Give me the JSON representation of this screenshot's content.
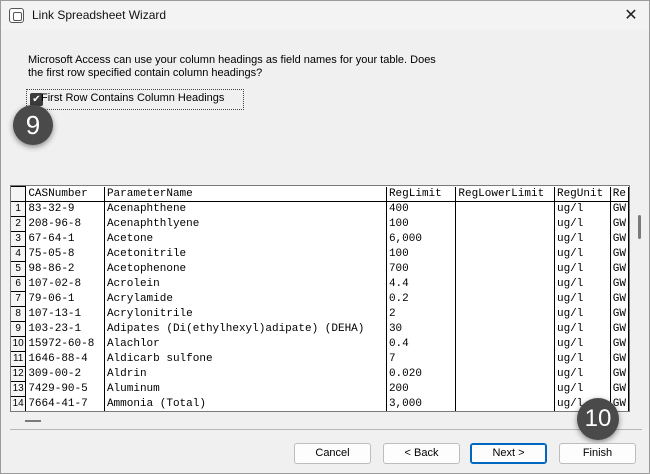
{
  "window": {
    "title": "Link Spreadsheet Wizard",
    "close_symbol": "✕"
  },
  "instructions": "Microsoft Access can use your column headings as field names for your table. Does the first row specified contain column headings?",
  "checkbox": {
    "label": "First Row Contains Column Headings",
    "checked": true,
    "mark": "✔"
  },
  "badges": {
    "step_9": "9",
    "step_10": "10"
  },
  "grid": {
    "columns": [
      "CASNumber",
      "ParameterName",
      "RegLimit",
      "RegLowerLimit",
      "RegUnit",
      "Re"
    ],
    "rows": [
      {
        "num": "1",
        "cells": [
          "83-32-9",
          "Acenaphthene",
          "400",
          "",
          "ug/l",
          "GW"
        ]
      },
      {
        "num": "2",
        "cells": [
          "208-96-8",
          "Acenaphthlyene",
          "100",
          "",
          "ug/l",
          "GW"
        ]
      },
      {
        "num": "3",
        "cells": [
          "67-64-1",
          "Acetone",
          "6,000",
          "",
          "ug/l",
          "GW"
        ]
      },
      {
        "num": "4",
        "cells": [
          "75-05-8",
          "Acetonitrile",
          "100",
          "",
          "ug/l",
          "GW"
        ]
      },
      {
        "num": "5",
        "cells": [
          "98-86-2",
          "Acetophenone",
          "700",
          "",
          "ug/l",
          "GW"
        ]
      },
      {
        "num": "6",
        "cells": [
          "107-02-8",
          "Acrolein",
          "4.4",
          "",
          "ug/l",
          "GW"
        ]
      },
      {
        "num": "7",
        "cells": [
          "79-06-1",
          "Acrylamide",
          "0.2",
          "",
          "ug/l",
          "GW"
        ]
      },
      {
        "num": "8",
        "cells": [
          "107-13-1",
          "Acrylonitrile",
          "2",
          "",
          "ug/l",
          "GW"
        ]
      },
      {
        "num": "9",
        "cells": [
          "103-23-1",
          "Adipates (Di(ethylhexyl)adipate) (DEHA)",
          "30",
          "",
          "ug/l",
          "GW"
        ]
      },
      {
        "num": "10",
        "cells": [
          "15972-60-8",
          "Alachlor",
          "0.4",
          "",
          "ug/l",
          "GW"
        ]
      },
      {
        "num": "11",
        "cells": [
          "1646-88-4",
          "Aldicarb sulfone",
          "7",
          "",
          "ug/l",
          "GW"
        ]
      },
      {
        "num": "12",
        "cells": [
          "309-00-2",
          "Aldrin",
          "0.020",
          "",
          "ug/l",
          "GW"
        ]
      },
      {
        "num": "13",
        "cells": [
          "7429-90-5",
          "Aluminum",
          "200",
          "",
          "ug/l",
          "GW"
        ]
      },
      {
        "num": "14",
        "cells": [
          "7664-41-7",
          "Ammonia (Total)",
          "3,000",
          "",
          "ug/l",
          "GW"
        ]
      }
    ]
  },
  "buttons": {
    "cancel": "Cancel",
    "back": "< Back",
    "next": "Next >",
    "finish": "Finish"
  },
  "colors": {
    "accent": "#0067c0",
    "badge": "#4a4a4a"
  }
}
